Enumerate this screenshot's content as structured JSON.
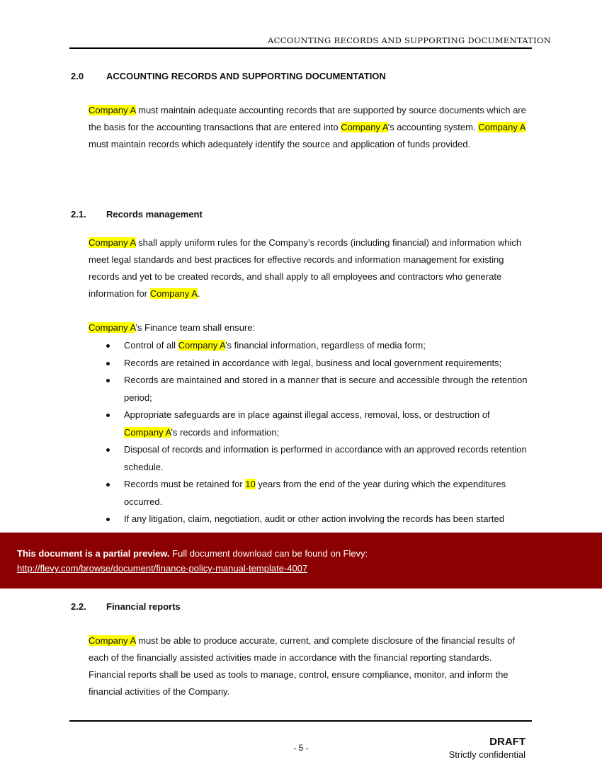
{
  "header": {
    "running_title": "ACCOUNTING RECORDS AND SUPPORTING DOCUMENTATION"
  },
  "section_2_0": {
    "number": "2.0",
    "title": "ACCOUNTING RECORDS AND SUPPORTING DOCUMENTATION",
    "paragraph": [
      {
        "t": "Company A",
        "hl": true
      },
      {
        "t": " must maintain adequate accounting records that are supported by source documents which are the basis for the accounting transactions that are entered into "
      },
      {
        "t": "Company A",
        "hl": true
      },
      {
        "t": "’s accounting system. "
      },
      {
        "t": "Company A",
        "hl": true
      },
      {
        "t": " must maintain records which adequately identify the source and application of funds provided."
      }
    ]
  },
  "section_2_1": {
    "number": "2.1.",
    "title": "Records management",
    "paragraph": [
      {
        "t": "Company A",
        "hl": true
      },
      {
        "t": " shall apply uniform rules for the Company’s records (including financial) and information which meet legal standards and best practices for effective records and information management for existing records and yet to be created records, and shall apply to all employees and contractors who generate information for "
      },
      {
        "t": "Company A",
        "hl": true
      },
      {
        "t": "."
      }
    ],
    "intro": [
      {
        "t": "Company A",
        "hl": true
      },
      {
        "t": "’s Finance team shall ensure:"
      }
    ],
    "bullets": [
      [
        {
          "t": "Control of all "
        },
        {
          "t": "Company A",
          "hl": true
        },
        {
          "t": "’s financial information, regardless of media form;"
        }
      ],
      [
        {
          "t": "Records are retained in accordance with legal, business and local government requirements;"
        }
      ],
      [
        {
          "t": "Records are maintained and stored in a manner that is secure and accessible through the retention period;"
        }
      ],
      [
        {
          "t": "Appropriate safeguards are in place against illegal access, removal, loss, or destruction of "
        },
        {
          "t": "Company A",
          "hl": true
        },
        {
          "t": "’s records and information;"
        }
      ],
      [
        {
          "t": "Disposal of records and information is performed in accordance with an approved records retention schedule."
        }
      ],
      [
        {
          "t": "Records must be retained for "
        },
        {
          "t": "10",
          "hl": true
        },
        {
          "t": " years from the end of the year during which the expenditures occurred."
        }
      ],
      [
        {
          "t": "If any litigation, claim, negotiation, audit or other action involving the records has been started"
        }
      ]
    ]
  },
  "preview_banner": {
    "bold": "This document is a partial preview.",
    "text": " Full document download can be found on Flevy:",
    "link": "http://flevy.com/browse/document/finance-policy-manual-template-4007",
    "color": "#8b0000"
  },
  "section_2_2": {
    "number": "2.2.",
    "title": "Financial reports",
    "paragraph": [
      {
        "t": "Company A",
        "hl": true
      },
      {
        "t": " must be able to produce accurate, current, and complete disclosure of the financial results of each of the financially assisted activities made in accordance with the financial reporting standards. Financial reports shall be used as tools to manage, control, ensure compliance, monitor, and inform the financial activities of the Company."
      }
    ]
  },
  "footer": {
    "page": "- 5 -",
    "draft": "DRAFT",
    "confidential": "Strictly confidential"
  },
  "colors": {
    "highlight": "#ffff00"
  }
}
